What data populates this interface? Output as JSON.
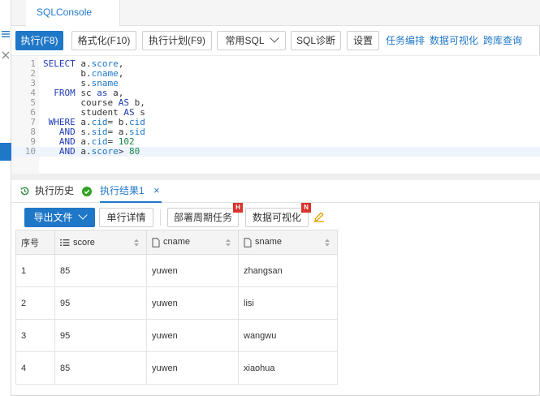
{
  "app": {
    "tab_title": "SQLConsole"
  },
  "toolbar": {
    "run": "执行(F8)",
    "format": "格式化(F10)",
    "plan": "执行计划(F9)",
    "common_sql": "常用SQL",
    "diagnose": "SQL诊断",
    "settings": "设置",
    "task_orchestration": "任务编排",
    "data_visualization": "数据可视化",
    "cross_db_query": "跨库查询"
  },
  "editor": {
    "line_numbers": [
      "1",
      "2",
      "3",
      "4",
      "5",
      "6",
      "7",
      "8",
      "9",
      "10"
    ]
  },
  "results": {
    "history_tab": "执行历史",
    "result_tab": "执行结果1",
    "export": "导出文件",
    "row_detail": "单行详情",
    "schedule_task": "部署周期任务",
    "schedule_badge": "H",
    "visualize": "数据可视化",
    "visualize_badge": "N",
    "columns": [
      "序号",
      "score",
      "cname",
      "sname"
    ],
    "rows": [
      [
        "1",
        "85",
        "yuwen",
        "zhangsan"
      ],
      [
        "2",
        "95",
        "yuwen",
        "lisi"
      ],
      [
        "3",
        "95",
        "yuwen",
        "wangwu"
      ],
      [
        "4",
        "85",
        "yuwen",
        "xiaohua"
      ]
    ]
  },
  "colors": {
    "accent": "#1f77c7",
    "badge": "#d9332b",
    "success": "#2ea121"
  }
}
